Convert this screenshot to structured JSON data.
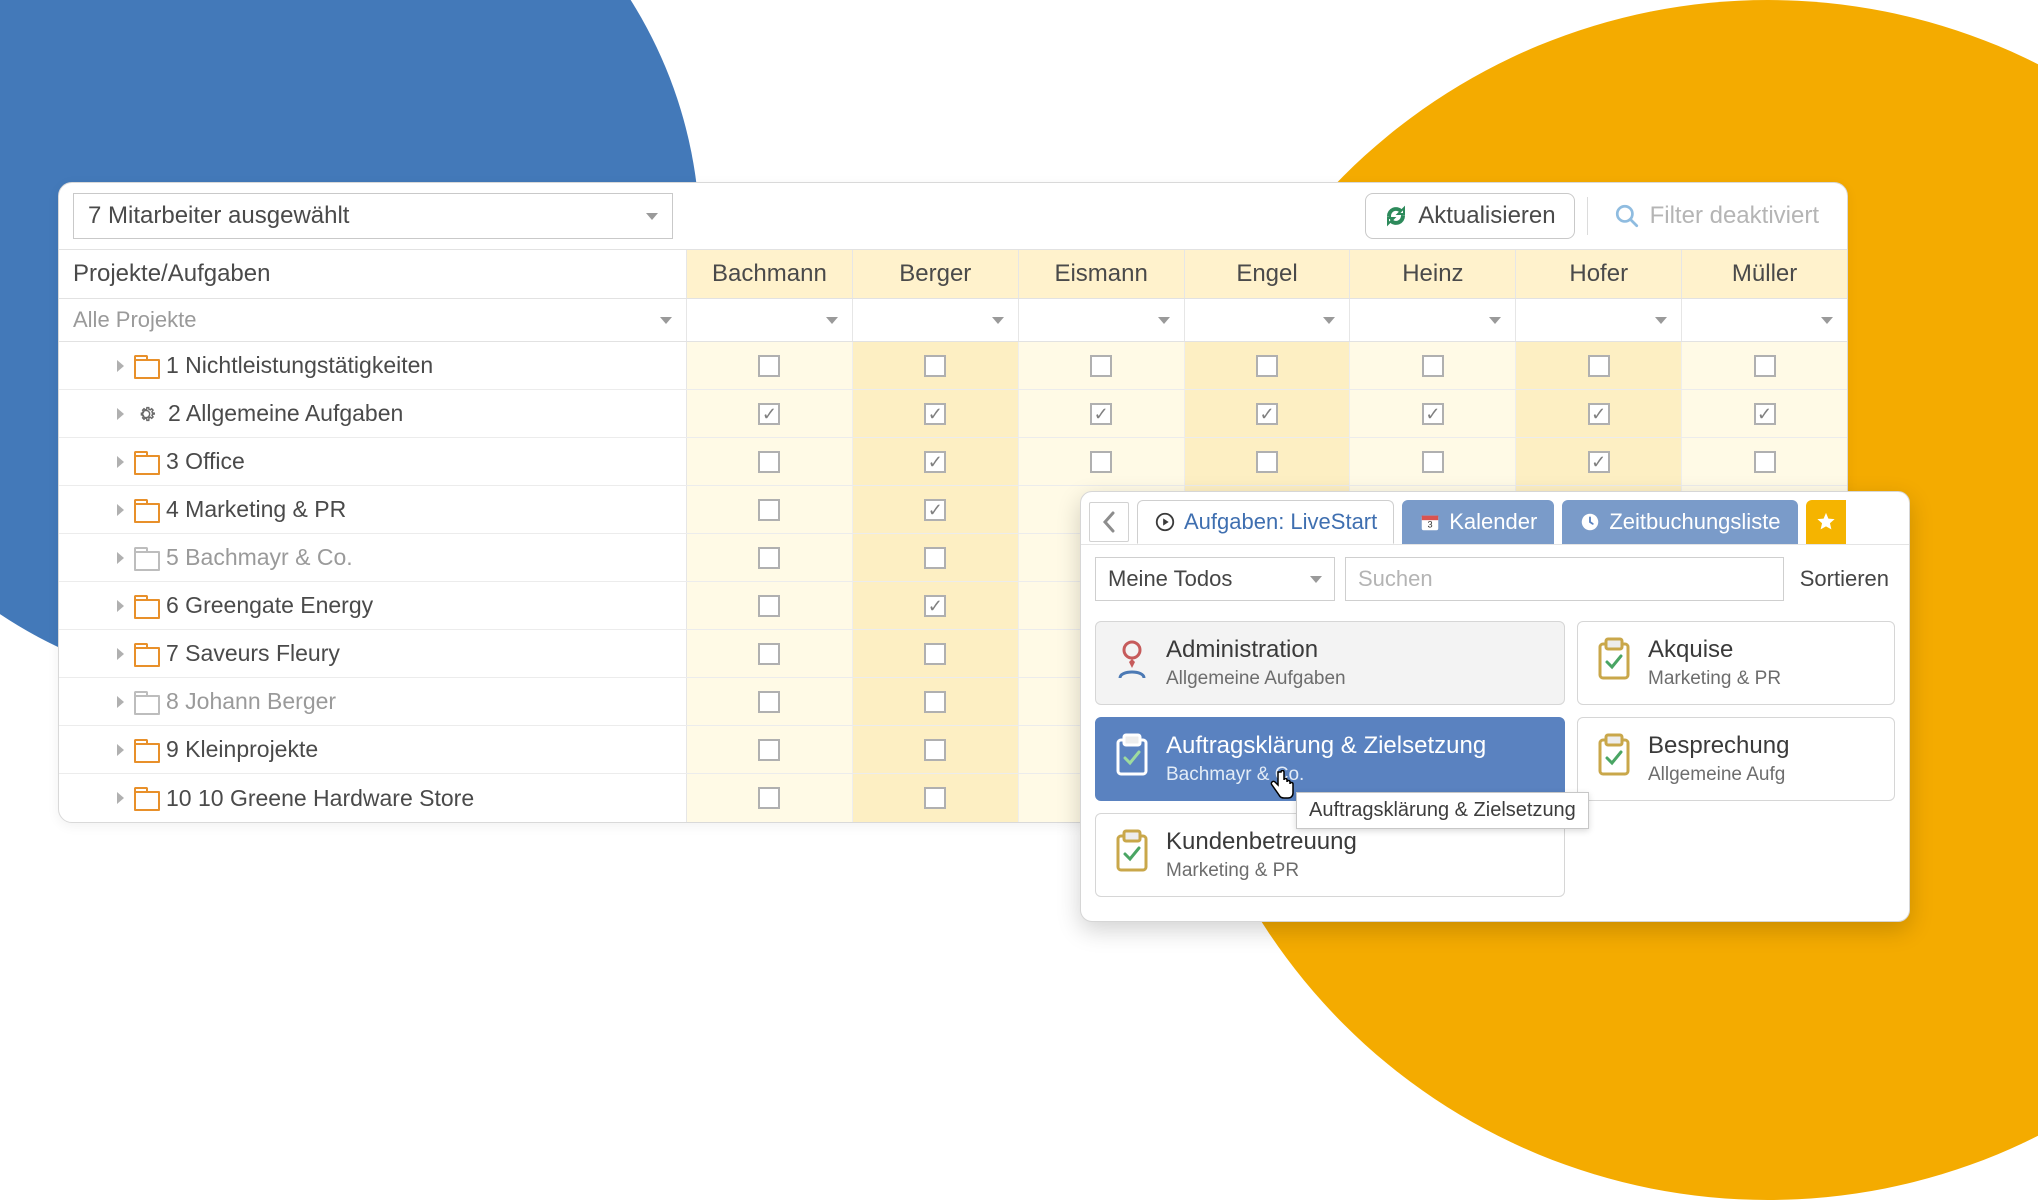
{
  "toolbar": {
    "employee_select": "7 Mitarbeiter ausgewählt",
    "refresh": "Aktualisieren",
    "filter": "Filter deaktiviert"
  },
  "grid": {
    "header_first": "Projekte/Aufgaben",
    "filter_first": "Alle Projekte",
    "columns": [
      "Bachmann",
      "Berger",
      "Eismann",
      "Engel",
      "Heinz",
      "Hofer",
      "Müller"
    ],
    "rows": [
      {
        "label": "1 Nichtleistungstätigkeiten",
        "icon": "folder-orange",
        "dim": false,
        "cells": [
          false,
          false,
          false,
          false,
          false,
          false,
          false
        ]
      },
      {
        "label": "2 Allgemeine Aufgaben",
        "icon": "gear",
        "dim": false,
        "cells": [
          true,
          true,
          true,
          true,
          true,
          true,
          true
        ]
      },
      {
        "label": "3 Office",
        "icon": "folder-orange",
        "dim": false,
        "cells": [
          false,
          true,
          false,
          false,
          false,
          true,
          false
        ]
      },
      {
        "label": "4 Marketing & PR",
        "icon": "folder-orange",
        "dim": false,
        "cells": [
          false,
          true,
          null,
          null,
          null,
          null,
          null
        ]
      },
      {
        "label": "5 Bachmayr & Co.",
        "icon": "folder-gray",
        "dim": true,
        "cells": [
          false,
          false,
          null,
          null,
          null,
          null,
          null
        ]
      },
      {
        "label": "6 Greengate Energy",
        "icon": "folder-orange",
        "dim": false,
        "cells": [
          false,
          true,
          null,
          null,
          null,
          null,
          null
        ]
      },
      {
        "label": "7 Saveurs Fleury",
        "icon": "folder-orange",
        "dim": false,
        "cells": [
          false,
          false,
          null,
          null,
          null,
          null,
          null
        ]
      },
      {
        "label": "8 Johann Berger",
        "icon": "folder-gray",
        "dim": true,
        "cells": [
          false,
          false,
          null,
          null,
          null,
          null,
          null
        ]
      },
      {
        "label": "9 Kleinprojekte",
        "icon": "folder-orange",
        "dim": false,
        "cells": [
          false,
          false,
          null,
          null,
          null,
          null,
          null
        ]
      },
      {
        "label": "10 10 Greene Hardware Store",
        "icon": "folder-orange",
        "dim": false,
        "cells": [
          false,
          false,
          null,
          null,
          null,
          null,
          null
        ]
      }
    ]
  },
  "overlay": {
    "tabs": {
      "active": "Aufgaben: LiveStart",
      "calendar": "Kalender",
      "bookings": "Zeitbuchungsliste"
    },
    "controls": {
      "select": "Meine Todos",
      "search_placeholder": "Suchen",
      "sort": "Sortieren"
    },
    "cards": [
      {
        "title": "Administration",
        "sub": "Allgemeine Aufgaben",
        "icon": "person",
        "style": "gray"
      },
      {
        "title": "Akquise",
        "sub": "Marketing & PR",
        "icon": "clip",
        "style": "white"
      },
      {
        "title": "Auftragsklärung & Zielsetzung",
        "sub": "Bachmayr & Co.",
        "icon": "clip",
        "style": "selected"
      },
      {
        "title": "Besprechung",
        "sub": "Allgemeine Aufg",
        "icon": "clip",
        "style": "white"
      },
      {
        "title": "Kundenbetreuung",
        "sub": "Marketing & PR",
        "icon": "clip",
        "style": "white"
      }
    ],
    "tooltip": "Auftragsklärung & Zielsetzung"
  }
}
